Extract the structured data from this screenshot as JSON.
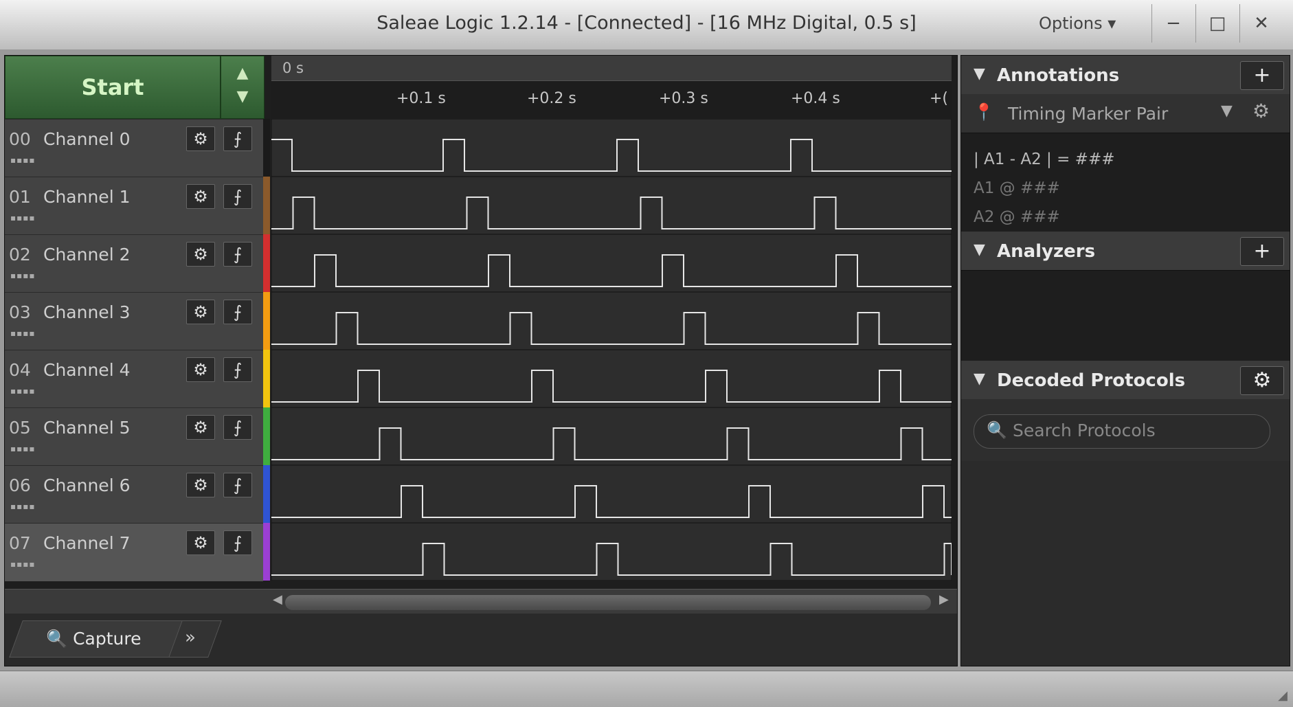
{
  "window": {
    "title": "Saleae Logic 1.2.14 - [Connected] - [16 MHz Digital, 0.5 s]",
    "options_label": "Options",
    "minimize_glyph": "−",
    "maximize_glyph": "□",
    "close_glyph": "✕"
  },
  "capture": {
    "start_label": "Start",
    "up_glyph": "▲",
    "down_glyph": "▼"
  },
  "channels": [
    {
      "num": "00",
      "name": "Channel 0",
      "color": "#1a1a1a"
    },
    {
      "num": "01",
      "name": "Channel 1",
      "color": "#8b5a2b"
    },
    {
      "num": "02",
      "name": "Channel 2",
      "color": "#d32f2f"
    },
    {
      "num": "03",
      "name": "Channel 3",
      "color": "#f39c12"
    },
    {
      "num": "04",
      "name": "Channel 4",
      "color": "#f1c40f"
    },
    {
      "num": "05",
      "name": "Channel 5",
      "color": "#3fae3f"
    },
    {
      "num": "06",
      "name": "Channel 6",
      "color": "#2f54d3"
    },
    {
      "num": "07",
      "name": "Channel 7",
      "color": "#9b3fd3"
    }
  ],
  "timeline": {
    "origin_label": "0 s",
    "ticks": [
      "+0.1 s",
      "+0.2 s",
      "+0.3 s",
      "+0.4 s",
      "+("
    ]
  },
  "bottom_tabs": {
    "capture_label": "Capture",
    "more_glyph": "»"
  },
  "annotations": {
    "header": "Annotations",
    "plus_glyph": "+",
    "marker_label": "Timing Marker Pair",
    "formula": "| A1 - A2 | = ###",
    "a1_line": "A1 @ ###",
    "a2_line": "A2 @ ###"
  },
  "analyzers": {
    "header": "Analyzers",
    "plus_glyph": "+"
  },
  "decoded": {
    "header": "Decoded Protocols",
    "gear_glyph": "⚙",
    "search_placeholder": "Search Protocols"
  }
}
